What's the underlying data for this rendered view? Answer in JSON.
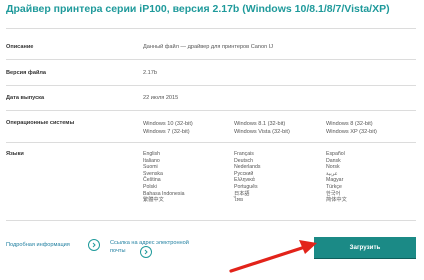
{
  "page": {
    "title": "Драйвер принтера серии iP100, версия 2.17b (Windows 10/8.1/8/7/Vista/XP)"
  },
  "details": {
    "description_label": "Описание",
    "description_value": "Данный файл — драйвер для принтеров Canon IJ",
    "version_label": "Версия файла",
    "version_value": "2.17b",
    "release_label": "Дата выпуска",
    "release_value": "22 июля 2015",
    "os_label": "Операционные системы",
    "os_columns": [
      [
        "Windows 10 (32-bit)",
        "Windows 7 (32-bit)"
      ],
      [
        "Windows 8.1 (32-bit)",
        "Windows Vista (32-bit)"
      ],
      [
        "Windows 8 (32-bit)",
        "Windows XP (32-bit)"
      ]
    ],
    "languages_label": "Языки",
    "language_columns": [
      [
        "English",
        "Italiano",
        "Suomi",
        "Svenska",
        "Čeština",
        "Polski",
        "Bahasa Indonesia",
        "繁體中文"
      ],
      [
        "Français",
        "Deutsch",
        "Nederlands",
        "Русский",
        "Ελληνικά",
        "Português",
        "日本語",
        "ไทย"
      ],
      [
        "Español",
        "Dansk",
        "Norsk",
        "عربية",
        "Magyar",
        "Türkçe",
        "한국어",
        "简体中文"
      ]
    ]
  },
  "footer": {
    "more_info": "Подробная информация",
    "email_link_line1": "Ссылка на адрес электронной",
    "email_link_line2": "почты",
    "download_button": "Загрузить"
  },
  "colors": {
    "accent": "#1f9a9b",
    "button": "#1b8a86",
    "arrow": "#e2231a"
  }
}
